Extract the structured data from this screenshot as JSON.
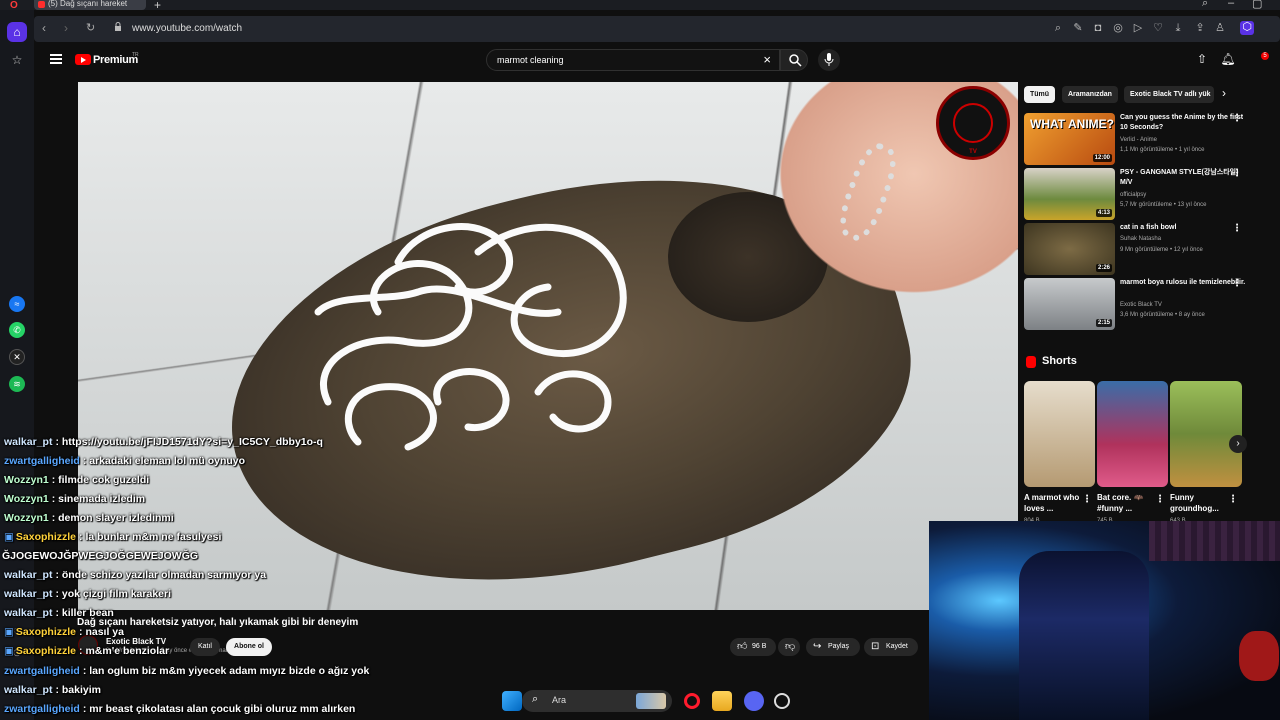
{
  "browser": {
    "tab_title": "(5) Dağ sıçanı hareket",
    "url": "www.youtube.com/watch"
  },
  "youtube": {
    "brand": "Premium",
    "brand_tm": "TR",
    "search_query": "marmot cleaning"
  },
  "video": {
    "watermark_text": "TV",
    "title": "Dağ sıçanı hareketsiz yatıyor, halı yıkamak gibi bir deneyim",
    "channel_name": "Exotic Black TV",
    "channel_subs": "3,4 Mn görüntüleme  9 ay önce  #marmot #mahalleye",
    "join_label": "Katıl",
    "subscribe_label": "Abone ol",
    "like_count": "96 B",
    "share_label": "Paylaş",
    "save_label": "Kaydet"
  },
  "chips": [
    "Tümü",
    "Aramanızdan",
    "Exotic Black TV adlı yük"
  ],
  "recommended": [
    {
      "title": "Can you guess the Anime by the first 10 Seconds?",
      "channel": "Verlid - Anime",
      "meta": "1,1 Mn görüntüleme • 1 yıl önce",
      "duration": "12:00",
      "thumb_text": "WHAT ANIME?",
      "thumb_color": "#d97b1b"
    },
    {
      "title": "PSY - GANGNAM STYLE(강남스타일) M/V",
      "channel": "officialpsy",
      "meta": "5,7 Mr görüntüleme • 13 yıl önce",
      "duration": "4:13",
      "thumb_text": "",
      "thumb_color": "#3b3b3b"
    },
    {
      "title": "cat in a fish bowl",
      "channel": "Suhak Natasha",
      "meta": "9 Mn görüntüleme • 12 yıl önce",
      "duration": "2:26",
      "thumb_text": "",
      "thumb_color": "#6b5a3a"
    },
    {
      "title": "marmot boya rulosu ile temizlenebilir.",
      "channel": "Exotic Black TV",
      "meta": "3,6 Mn görüntüleme • 8 ay önce",
      "duration": "2:15",
      "thumb_text": "",
      "thumb_color": "#8a8f93"
    }
  ],
  "shorts": {
    "heading": "Shorts",
    "items": [
      {
        "title": "A marmot who loves ...",
        "views": "804 B",
        "color": "#c9b89a"
      },
      {
        "title": "Bat core. 🦇 #funny ...",
        "views": "745 B",
        "color": "#b0325c"
      },
      {
        "title": "Funny groundhog...",
        "views": "643 B",
        "color": "#6f8a3a"
      }
    ]
  },
  "chat": [
    {
      "user": "walkar_pt",
      "text": ": https://youtu.be/jFIJD1571dY?si=y_IC5CY_dbby1o-q",
      "color": "#cfe6ff"
    },
    {
      "user": "zwartgalligheid",
      "text": ": arkadaki eleman lol mü oynuyo",
      "color": "#5aa7ff"
    },
    {
      "user": "Wozzyn1",
      "text": ": filmde cok guzeldi",
      "color": "#bfffd0"
    },
    {
      "user": "Wozzyn1",
      "text": ": sinemada izledim",
      "color": "#bfffd0"
    },
    {
      "user": "Wozzyn1",
      "text": ": demon slayer izledinmi",
      "color": "#bfffd0"
    },
    {
      "user": "Saxophizzle",
      "text": ": la bunlar m&m ne fasulyesi",
      "color": "#ffd23a"
    },
    {
      "user": "",
      "text": "ĞJOGEWOJĞPWEGJOĞGEWEJOWĞG",
      "color": "#ffffff"
    },
    {
      "user": "walkar_pt",
      "text": ": önde schizo yazılar olmadan sarmıyor ya",
      "color": "#cfe6ff"
    },
    {
      "user": "walkar_pt",
      "text": ": yok çizgi film karakeri",
      "color": "#cfe6ff"
    },
    {
      "user": "walkar_pt",
      "text": ": killer bean",
      "color": "#cfe6ff"
    },
    {
      "user": "Saxophizzle",
      "text": ": nasıl ya",
      "color": "#ffd23a"
    },
    {
      "user": "Saxophizzle",
      "text": ": m&m'e benziolar",
      "color": "#ffd23a"
    },
    {
      "user": "zwartgalligheid",
      "text": ": lan oglum biz m&m yiyecek adam mıyız bizde o ağız yok",
      "color": "#5aa7ff"
    },
    {
      "user": "walkar_pt",
      "text": ": bakiyim",
      "color": "#cfe6ff"
    },
    {
      "user": "zwartgalligheid",
      "text": ": mr beast çikolatası alan çocuk gibi oluruz mm alırken",
      "color": "#5aa7ff"
    }
  ],
  "taskbar": {
    "search_placeholder": "Ara"
  },
  "icons": {
    "sidebar": [
      "home-icon",
      "star-icon",
      "messenger-icon",
      "whatsapp-icon",
      "x-icon",
      "spotify-icon"
    ]
  }
}
